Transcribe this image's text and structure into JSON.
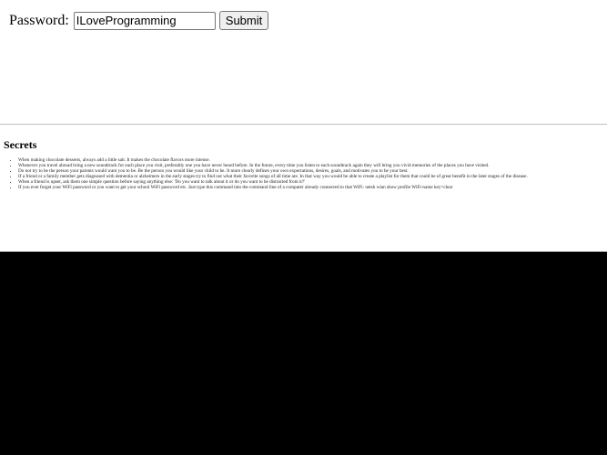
{
  "login": {
    "label": "Password:",
    "password_value": "ILoveProgramming",
    "submit_label": "Submit"
  },
  "secrets": {
    "heading": "Secrets",
    "items": [
      "When making chocolate desserts, always add a little salt. It makes the chocolate flavors more intense.",
      "Whenever you travel abroad bring a new soundtrack for each place you visit, preferably one you have never heard before. In the future, every time you listen to each soundtrack again they will bring you vivid memories of the places you have visited.",
      "Do not try to be the person your parents would want you to be. Be the person you would like your child to be. It more clearly defines your own expectations, desires, goals, and motivates you to be your best.",
      "If a friend or a family member gets diagnosed with dementia or alzheimers in the early stages try to find out what their favorite songs of all time are. In that way you would be able to create a playlist for them that could be of great benefit in the later stages of the disease.",
      "When a friend is upset, ask them one simple question before saying anything else: 'Do you want to talk about it or do you want to be distracted from it?'",
      "If you ever forget your WiFi password or you want to get your school WiFi password etc. Just type this command into the command line of a computer already connected to that WiFi: netsh wlan show profile WiFi-name key=clear"
    ]
  }
}
